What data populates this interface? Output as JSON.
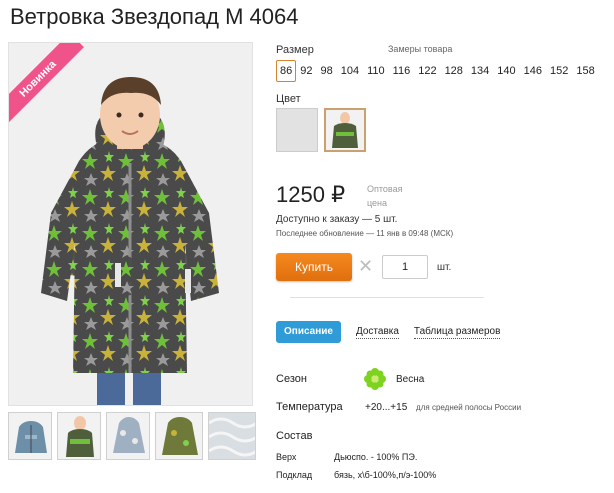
{
  "product": {
    "title": "Ветровка Звездопад М 4064",
    "badge": "Новинка"
  },
  "sizes": {
    "label": "Размер",
    "chart_link": "Замеры товара",
    "options": [
      "86",
      "92",
      "98",
      "104",
      "110",
      "116",
      "122",
      "128",
      "134",
      "140",
      "146",
      "152",
      "158"
    ],
    "selected": "86"
  },
  "color": {
    "label": "Цвет"
  },
  "price": {
    "value": "1250",
    "currency": "₽",
    "wholesale_label": "Оптовая цена"
  },
  "availability": {
    "text": "Доступно к заказу — 5 шт.",
    "updated": "Последнее обновление — 11 янв в 09:48 (МСК)"
  },
  "buy": {
    "button_label": "Купить",
    "times": "✕",
    "quantity": "1",
    "unit": "шт."
  },
  "tabs": [
    "Описание",
    "Доставка",
    "Таблица размеров"
  ],
  "details": {
    "season_label": "Сезон",
    "season_value": "Весна",
    "temperature_label": "Температура",
    "temperature_value": "+20...+15",
    "temperature_note": "для средней полосы России",
    "composition_label": "Состав",
    "top_label": "Верх",
    "top_value": "Дьюспо. - 100% ПЭ.",
    "lining_label": "Подклад",
    "lining_value": "бязь, х\\б-100%,п/э-100%"
  },
  "colors": {
    "accent_orange": "#e97a17",
    "tab_blue": "#2f9bd7",
    "badge_pink": "#f0528a",
    "season_flower": "#7ed321"
  }
}
